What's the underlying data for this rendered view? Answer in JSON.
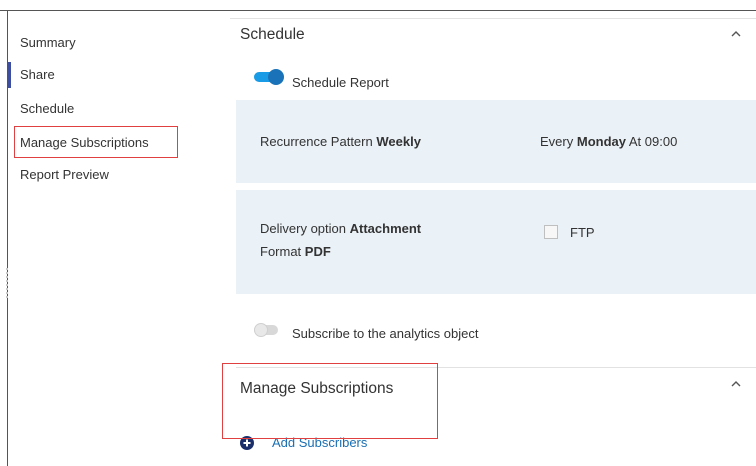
{
  "nav": {
    "items": [
      {
        "label": "Summary"
      },
      {
        "label": "Share"
      },
      {
        "label": "Schedule"
      },
      {
        "label": "Manage Subscriptions"
      },
      {
        "label": "Report Preview"
      }
    ],
    "active_item": "Share",
    "highlighted_item": "Manage Subscriptions"
  },
  "schedule": {
    "title": "Schedule",
    "chevron_icon": "chevron-up-icon",
    "toggle": {
      "label": "Schedule Report",
      "on": true
    },
    "recurrence": {
      "label": "Recurrence Pattern",
      "value": "Weekly",
      "every": "Every",
      "day": "Monday",
      "at": "At 09:00"
    },
    "delivery": {
      "label": "Delivery option",
      "value": "Attachment",
      "format_label": "Format",
      "format_value": "PDF",
      "ftp_label": "FTP",
      "ftp_checked": false
    },
    "subscribe_toggle": {
      "label": "Subscribe to the analytics object",
      "on": false
    }
  },
  "manage_subscriptions": {
    "title": "Manage Subscriptions",
    "chevron_icon": "chevron-up-icon",
    "add_button": {
      "label": "Add Subscribers",
      "icon": "plus-circle-icon"
    }
  },
  "colors": {
    "accent": "#1a73b8",
    "panel_bg": "#eaf1f7",
    "highlight_border": "#e04040",
    "link": "#1a6fb3"
  }
}
